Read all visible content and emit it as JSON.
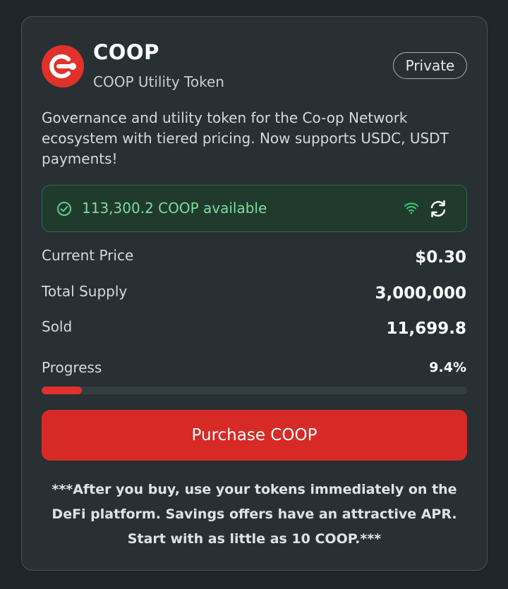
{
  "token": {
    "symbol": "COOP",
    "name": "COOP Utility Token",
    "visibility_badge": "Private",
    "logo_icon": "coop-logo"
  },
  "description": "Governance and utility token for the Co-op Network ecosystem with tiered pricing. Now supports USDC, USDT payments!",
  "availability": {
    "text": "113,300.2 COOP available",
    "status_icon": "check-circle-icon",
    "connection_icon": "wifi-icon",
    "refresh_icon": "refresh-icon"
  },
  "stats": {
    "current_price_label": "Current Price",
    "current_price_value": "$0.30",
    "total_supply_label": "Total Supply",
    "total_supply_value": "3,000,000",
    "sold_label": "Sold",
    "sold_value": "11,699.8"
  },
  "progress": {
    "label": "Progress",
    "value_text": "9.4%",
    "percent": 9.4
  },
  "purchase_button": "Purchase COOP",
  "footnote": "***After you buy, use your tokens immediately on the DeFi platform. Savings offers have an attractive APR. Start with as little as 10 COOP.***",
  "colors": {
    "accent": "#d72a26",
    "available_text": "#7fdc9f",
    "background": "#1f2528",
    "card": "#283034"
  }
}
